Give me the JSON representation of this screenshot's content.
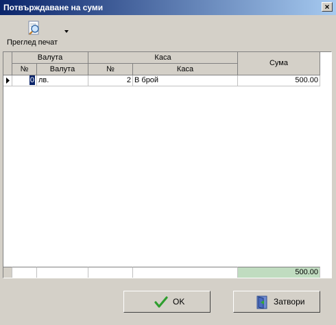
{
  "window": {
    "title": "Потвърждаване на суми",
    "close_label": "×"
  },
  "toolbar": {
    "preview_label": "Преглед печат",
    "preview_icon": "print-preview-icon"
  },
  "grid": {
    "groups": {
      "currency": "Валута",
      "cash": "Каса",
      "amount": "Сума"
    },
    "subheaders": {
      "currency_no": "№",
      "currency_name": "Валута",
      "cash_no": "№",
      "cash_name": "Каса"
    },
    "rows": [
      {
        "currency_no": "0",
        "currency_name": "лв.",
        "cash_no": "2",
        "cash_name": "В брой",
        "amount": "500.00"
      }
    ],
    "footer": {
      "total": "500.00"
    }
  },
  "buttons": {
    "ok_label": "OK",
    "close_label": "Затвори"
  },
  "colors": {
    "title_start": "#0a246a",
    "title_end": "#a6caf0",
    "footer_total_bg": "#c0dcc0",
    "selected_cell_bg": "#0a246a"
  }
}
